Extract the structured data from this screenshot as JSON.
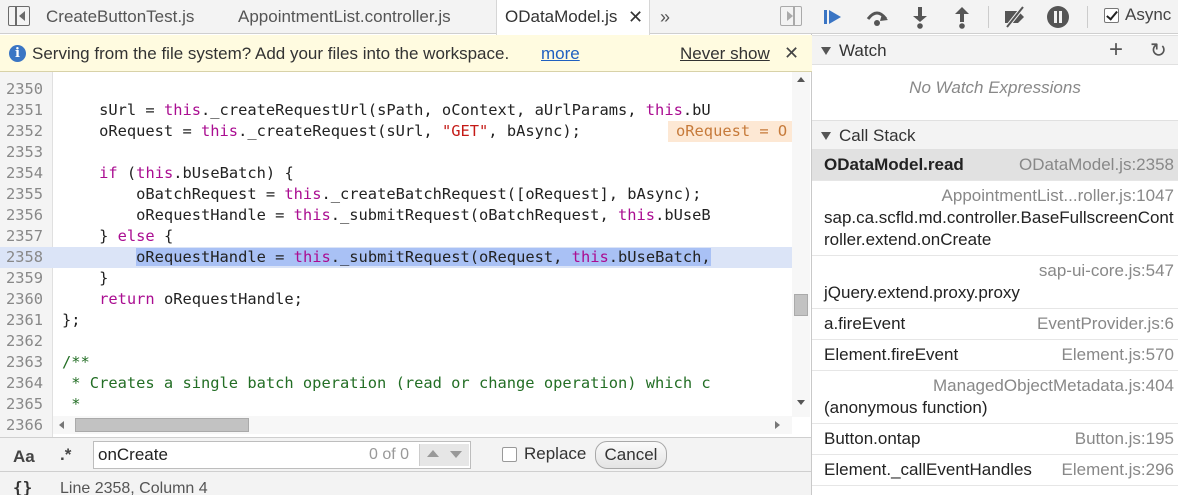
{
  "tabs": {
    "items": [
      {
        "label": "CreateButtonTest.js"
      },
      {
        "label": "AppointmentList.controller.js"
      },
      {
        "label": "ODataModel.js",
        "active": true
      }
    ],
    "close_glyph": "✕",
    "more_glyph": "»"
  },
  "infobar": {
    "message": "Serving from the file system? Add your files into the workspace.",
    "more_link": "more",
    "never_show": "Never show",
    "close_glyph": "✕",
    "info_glyph": "i"
  },
  "editor": {
    "current_line": 2358,
    "lines": [
      {
        "num": "2350",
        "code": ""
      },
      {
        "num": "2351",
        "code": "    sUrl = this._createRequestUrl(sPath, oContext, aUrlParams, this.bU"
      },
      {
        "num": "2352",
        "code": "    oRequest = this._createRequest(sUrl, \"GET\", bAsync);"
      },
      {
        "num": "2353",
        "code": ""
      },
      {
        "num": "2354",
        "code": "    if (this.bUseBatch) {"
      },
      {
        "num": "2355",
        "code": "        oBatchRequest = this._createBatchRequest([oRequest], bAsync);"
      },
      {
        "num": "2356",
        "code": "        oRequestHandle = this._submitRequest(oBatchRequest, this.bUseB"
      },
      {
        "num": "2357",
        "code": "    } else {"
      },
      {
        "num": "2358",
        "code": "        oRequestHandle = this._submitRequest(oRequest, this.bUseBatch,"
      },
      {
        "num": "2359",
        "code": "    }"
      },
      {
        "num": "2360",
        "code": "    return oRequestHandle;"
      },
      {
        "num": "2361",
        "code": "};"
      },
      {
        "num": "2362",
        "code": ""
      },
      {
        "num": "2363",
        "code": "/**"
      },
      {
        "num": "2364",
        "code": " * Creates a single batch operation (read or change operation) which c"
      },
      {
        "num": "2365",
        "code": " *"
      },
      {
        "num": "2366",
        "code": ""
      }
    ],
    "inline_value": "oRequest = O"
  },
  "search": {
    "match_case_label": "Aa",
    "regex_label": ".*",
    "query": "onCreate",
    "match_count": "0 of 0",
    "replace_label": "Replace",
    "cancel_label": "Cancel"
  },
  "status": {
    "pretty_print": "{}",
    "position": "Line 2358, Column 4"
  },
  "debugger": {
    "async_label": "Async",
    "async_checked": true,
    "watch_title": "Watch",
    "watch_add": "+",
    "watch_refresh": "↻",
    "watch_empty": "No Watch Expressions",
    "callstack_title": "Call Stack",
    "frames": [
      {
        "fn": "ODataModel.read",
        "loc": "ODataModel.js:2358",
        "selected": true
      },
      {
        "fn": "sap.ca.scfld.md.controller.BaseFullscreenController.extend.onCreate",
        "loc": "AppointmentList...roller.js:1047"
      },
      {
        "fn": "jQuery.extend.proxy.proxy",
        "loc": "sap-ui-core.js:547"
      },
      {
        "fn": "a.fireEvent",
        "loc": "EventProvider.js:6"
      },
      {
        "fn": "Element.fireEvent",
        "loc": "Element.js:570"
      },
      {
        "fn": "(anonymous function)",
        "loc": "ManagedObjectMetadata.js:404"
      },
      {
        "fn": "Button.ontap",
        "loc": "Button.js:195"
      },
      {
        "fn": "Element._callEventHandles",
        "loc": "Element.js:296"
      }
    ]
  },
  "colors": {
    "keyword": "#aa0d91",
    "string": "#c41a16",
    "comment": "#236e25",
    "selection": "#a9c1f5",
    "accent": "#2060c0"
  },
  "icons": [
    "navigator-toggle-icon",
    "debugger-toggle-icon",
    "resume-icon",
    "step-over-icon",
    "step-into-icon",
    "step-out-icon",
    "deactivate-breakpoints-icon",
    "pause-on-exceptions-icon",
    "info-icon"
  ]
}
